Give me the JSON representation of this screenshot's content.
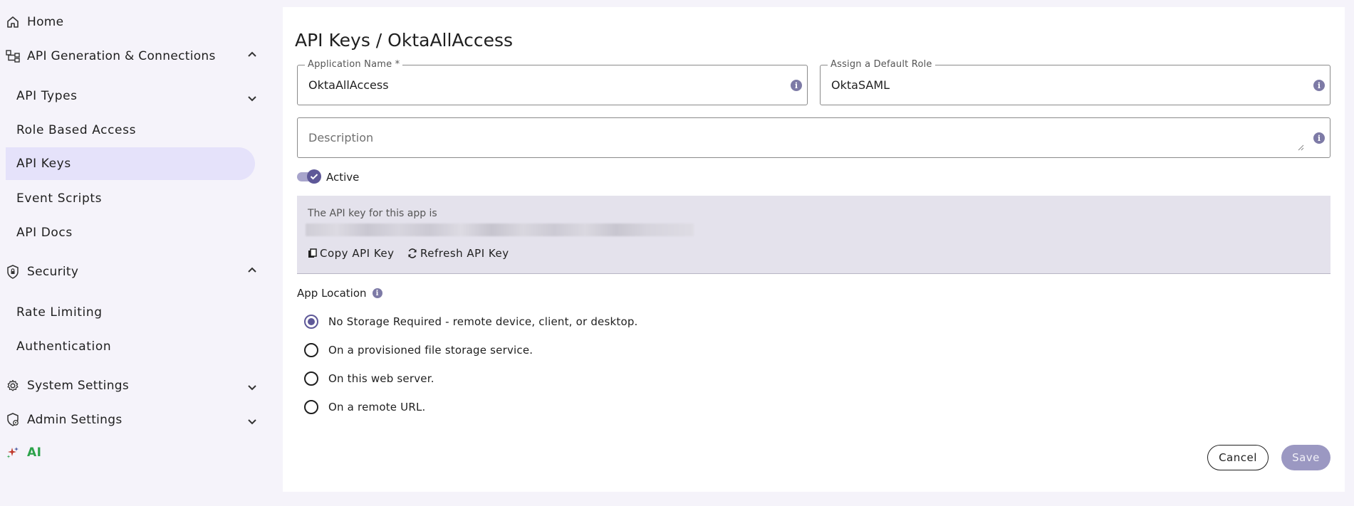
{
  "sidebar": {
    "home": "Home",
    "api_gen": "API Generation & Connections",
    "api_types": "API Types",
    "role_based_access": "Role Based Access",
    "api_keys": "API Keys",
    "event_scripts": "Event Scripts",
    "api_docs": "API Docs",
    "security": "Security",
    "rate_limiting": "Rate Limiting",
    "authentication": "Authentication",
    "system_settings": "System Settings",
    "admin_settings": "Admin Settings",
    "ai": "AI"
  },
  "page": {
    "title": "API Keys / OktaAllAccess"
  },
  "form": {
    "app_name_label": "Application Name *",
    "app_name_value": "OktaAllAccess",
    "role_label": "Assign a Default Role",
    "role_value": "OktaSAML",
    "description_placeholder": "Description",
    "active_label": "Active",
    "active": true
  },
  "api_key": {
    "header": "The API key for this app is",
    "copy_label": "Copy API Key",
    "refresh_label": "Refresh API Key"
  },
  "location": {
    "label": "App Location",
    "options": [
      "No Storage Required - remote device, client, or desktop.",
      "On a provisioned file storage service.",
      "On this web server.",
      "On a remote URL."
    ],
    "selected": "No Storage Required - remote device, client, or desktop."
  },
  "actions": {
    "cancel": "Cancel",
    "save": "Save"
  },
  "colors": {
    "accent": "#5e5898",
    "active_nav": "#e5e2fa",
    "ai_green": "#2ca24a"
  }
}
